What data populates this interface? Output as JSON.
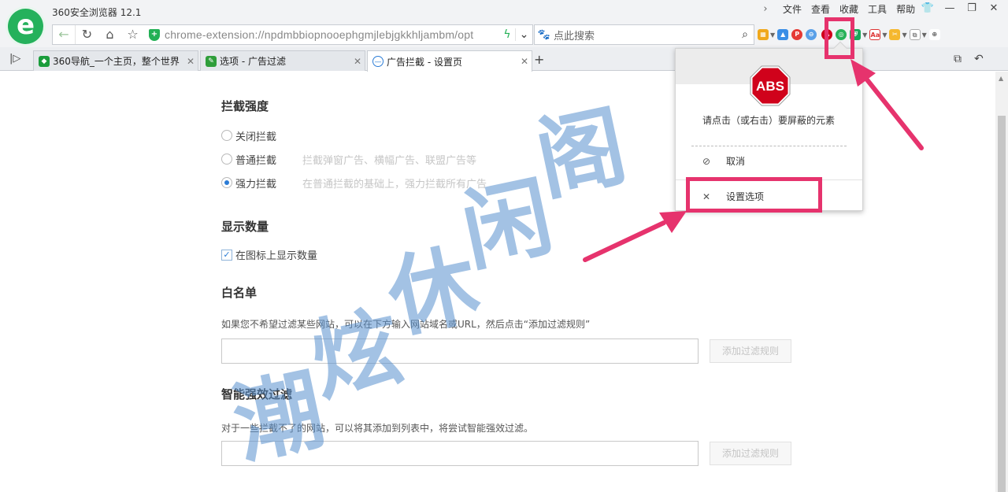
{
  "window": {
    "app_title": "360安全浏览器 12.1",
    "menu": [
      "文件",
      "查看",
      "收藏",
      "工具",
      "帮助"
    ],
    "logo_letter": "e"
  },
  "nav": {
    "url": "chrome-extension://npdmbbiopnooephgmjlebjgkkhljambm/opt",
    "search_placeholder": "点此搜索"
  },
  "tabs": [
    {
      "label": "360导航_一个主页，整个世界",
      "active": false,
      "icon_color": "#1a9c3c"
    },
    {
      "label": "选项 - 广告过滤",
      "active": false,
      "icon_color": "#2f9e3b"
    },
    {
      "label": "广告拦截 - 设置页",
      "active": true,
      "icon_color": "#2b7cd6"
    }
  ],
  "settings": {
    "level": {
      "title": "拦截强度",
      "options": [
        {
          "label": "关闭拦截",
          "desc": "",
          "selected": false
        },
        {
          "label": "普通拦截",
          "desc": "拦截弹窗广告、横幅广告、联盟广告等",
          "selected": false
        },
        {
          "label": "强力拦截",
          "desc": "在普通拦截的基础上，强力拦截所有广告",
          "selected": true
        }
      ]
    },
    "count": {
      "title": "显示数量",
      "checkbox_label": "在图标上显示数量",
      "checked": true
    },
    "whitelist": {
      "title": "白名单",
      "note": "如果您不希望过滤某些网站，可以在下方输入网站域名或URL，然后点击“添加过滤规则”",
      "input_value": "",
      "button": "添加过滤规则"
    },
    "smart": {
      "title": "智能强效过滤",
      "note": "对于一些拦截不了的网站，可以将其添加到列表中，将尝试智能强效过滤。",
      "input_value": "",
      "button": "添加过滤规则"
    }
  },
  "popup": {
    "logo_text": "ABS",
    "instruction": "请点击（或右击）要屏蔽的元素",
    "cancel": "取消",
    "options": "设置选项"
  },
  "watermark": [
    "潮",
    "炫",
    "休",
    "闲",
    "阁"
  ],
  "colors": {
    "accent": "#2b7cd6",
    "highlight": "#e6336d",
    "brand_green": "#25b15c",
    "abp_red": "#d0021b"
  }
}
